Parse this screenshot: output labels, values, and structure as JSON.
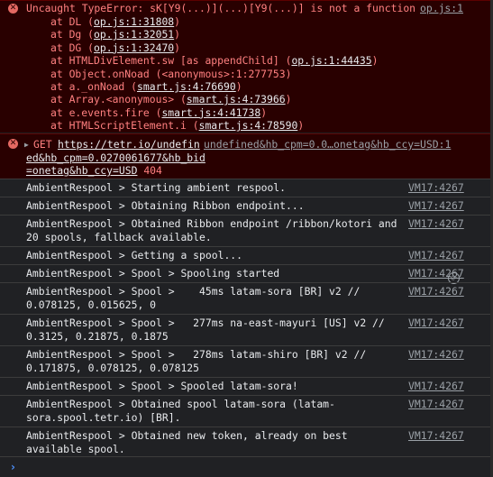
{
  "error1": {
    "title": "Uncaught TypeError: sK[Y9(...)](...)[Y9(...)] is not a function",
    "source": "op.js:1",
    "stack": [
      {
        "prefix": "at DL (",
        "link": "op.js:1:31808",
        "suffix": ")"
      },
      {
        "prefix": "at Dg (",
        "link": "op.js:1:32051",
        "suffix": ")"
      },
      {
        "prefix": "at DG (",
        "link": "op.js:1:32470",
        "suffix": ")"
      },
      {
        "prefix": "at HTMLDivElement.sw [as appendChild] (",
        "link": "op.js:1:44435",
        "suffix": ")"
      },
      {
        "prefix": "at Object.onNoad (<anonymous>:1:277753)",
        "link": "",
        "suffix": ""
      },
      {
        "prefix": "at a._onNoad (",
        "link": "smart.js:4:76690",
        "suffix": ")"
      },
      {
        "prefix": "at Array.<anonymous> (",
        "link": "smart.js:4:73966",
        "suffix": ")"
      },
      {
        "prefix": "at e.events.fire (",
        "link": "smart.js:4:41738",
        "suffix": ")"
      },
      {
        "prefix": "at HTMLScriptElement.i (",
        "link": "smart.js:4:78590",
        "suffix": ")"
      }
    ]
  },
  "error2": {
    "method": "GET",
    "url_line1": "https://tetr.io/undefin",
    "url_line2": "ed&hb_cpm=0.0270061677&hb_bid",
    "url_line3": "=onetag&hb_ccy=USD",
    "status": "404",
    "source": "undefined&hb_cpm=0.0…onetag&hb_ccy=USD:1"
  },
  "logs": [
    {
      "msg": "AmbientRespool > Starting ambient respool.",
      "src": "VM17:4267"
    },
    {
      "msg": "AmbientRespool > Obtaining Ribbon endpoint...",
      "src": "VM17:4267"
    },
    {
      "msg": "AmbientRespool > Obtained Ribbon endpoint /ribbon/kotori and 20 spools, fallback available.",
      "src": "VM17:4267"
    },
    {
      "msg": "AmbientRespool > Getting a spool...",
      "src": "VM17:4267"
    },
    {
      "msg": "AmbientRespool > Spool > Spooling started",
      "src": "VM17:4267"
    },
    {
      "msg": "AmbientRespool > Spool >    45ms latam-sora [BR] v2 // 0.078125, 0.015625, 0",
      "src": "VM17:4267"
    },
    {
      "msg": "AmbientRespool > Spool >   277ms na-east-mayuri [US] v2 // 0.3125, 0.21875, 0.1875",
      "src": "VM17:4267"
    },
    {
      "msg": "AmbientRespool > Spool >   278ms latam-shiro [BR] v2 // 0.171875, 0.078125, 0.078125",
      "src": "VM17:4267"
    },
    {
      "msg": "AmbientRespool > Spool > Spooled latam-sora!",
      "src": "VM17:4267"
    },
    {
      "msg": "AmbientRespool > Obtained spool latam-sora (latam-sora.spool.tetr.io) [BR].",
      "src": "VM17:4267"
    },
    {
      "msg": "AmbientRespool > Obtained new token, already on best available spool.",
      "src": "VM17:4267"
    }
  ],
  "prompt": "›",
  "colors": {
    "error_bg": "#290000",
    "error_text": "#ff8080",
    "link": "#9aa0a6",
    "prompt": "#4c8df6"
  }
}
